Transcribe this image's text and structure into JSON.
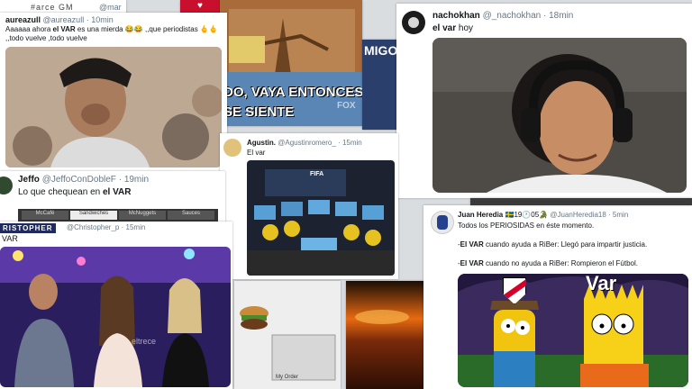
{
  "strip_top": {
    "text": "#arce GM",
    "handle": "@mar"
  },
  "tweet_aurea": {
    "name": "aureazull",
    "handle": "@aureazull",
    "time": "10min",
    "text_part1": "Aaaaaa ahora ",
    "text_var": "el VAR",
    "text_part2": " es una mierda 😂😂 ,,que periodistas 🖕🖕 ,,todo vuelve ,todo vuelve"
  },
  "simpsons_left": {
    "caption1": "DO, VAYA ENTONCES",
    "caption2": "SE SIENTE",
    "logo": "FOX"
  },
  "migo_strip": {
    "text": "MIGO"
  },
  "tweet_nacho": {
    "name": "nachokhan",
    "handle": "@_nachokhan",
    "time": "18min",
    "text_var": "el var",
    "text_rest": " hoy"
  },
  "tweet_agustin": {
    "name": "Agustin.",
    "handle": "@Agustinromero_",
    "time": "15min",
    "text": "El var",
    "screen_label": "FIFA"
  },
  "tweet_jeffo": {
    "name": "Jeffo",
    "handle": "@JeffoConDobleF",
    "time": "19min",
    "text_part1": "Lo que chequean en ",
    "text_var": "el VAR",
    "menu": [
      "McCafé",
      "Sandwiches",
      "McNuggets",
      "Sauces"
    ]
  },
  "tweet_christopher": {
    "name_banner": "RISTOPHER",
    "handle": "@Christopher_p",
    "time": "15min",
    "text": "VAR",
    "watermark": "eltrece"
  },
  "order_screen": {
    "label": "My Order"
  },
  "tweet_juan": {
    "name": "Juan Heredia",
    "name_badge": "🇸🇪19🕐05🐊",
    "handle": "@JuanHeredia18",
    "time": "5min",
    "line1": "Todos los PERIOSIDAS en éste momento.",
    "line2_prefix": "-",
    "line2_var": "El VAR",
    "line2_rest": " cuando ayuda a RiBer: Llegó para impartir justicia.",
    "line3_prefix": "-",
    "line3_var": "El VAR",
    "line3_rest": " cuando no ayuda a RiBer: Rompieron el Fútbol.",
    "meme_label": "Var"
  },
  "colors": {
    "name_blue": "#1da1f2",
    "text": "#14171a",
    "muted": "#657786",
    "river_red": "#d6002a"
  }
}
